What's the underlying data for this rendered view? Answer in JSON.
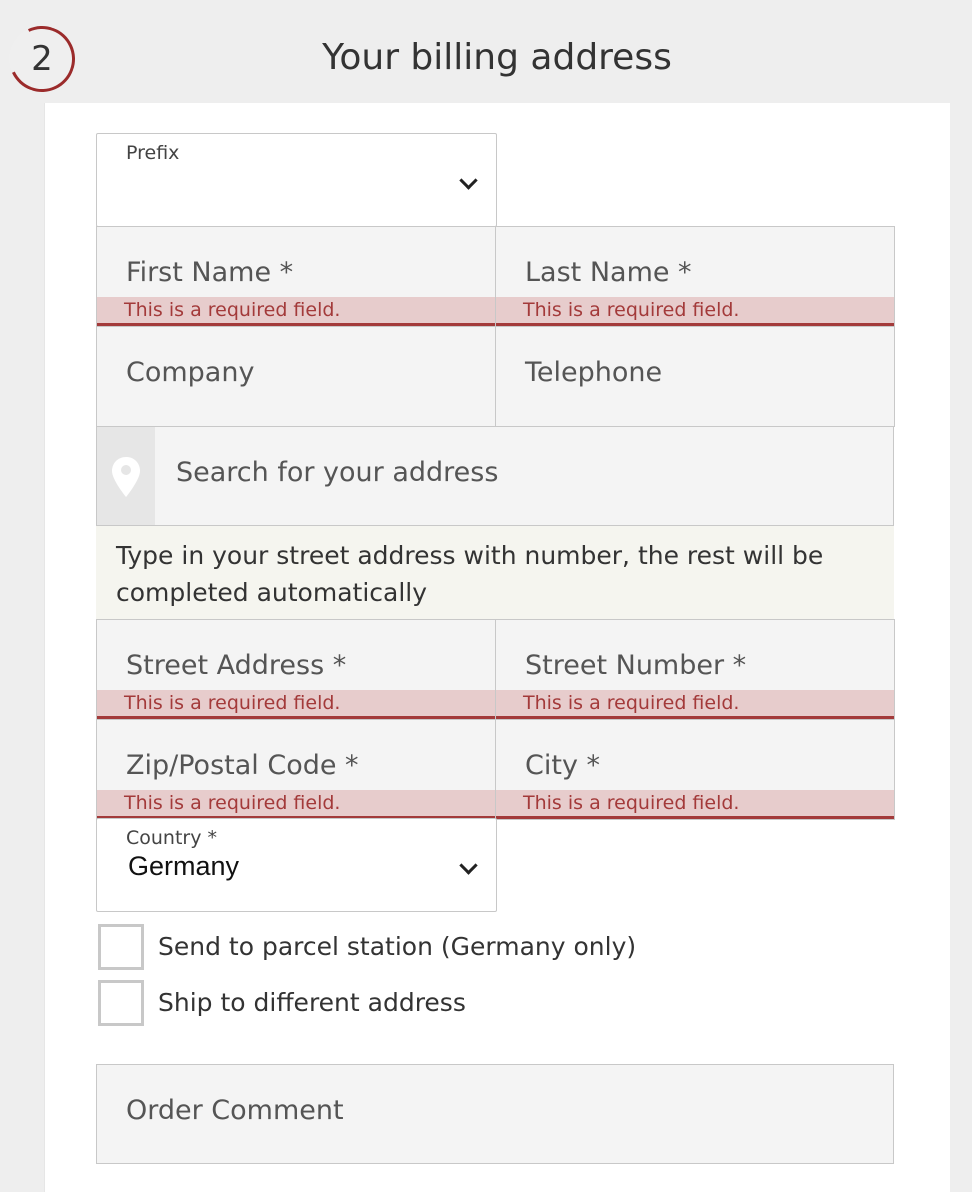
{
  "section": {
    "step_number": "2",
    "title": "Your billing address"
  },
  "form": {
    "prefix": {
      "label": "Prefix",
      "value": ""
    },
    "first_name": {
      "label": "First Name *",
      "error": "This is a required field."
    },
    "last_name": {
      "label": "Last Name *",
      "error": "This is a required field."
    },
    "company": {
      "label": "Company"
    },
    "telephone": {
      "label": "Telephone"
    },
    "address_search": {
      "placeholder": "Search for your address",
      "hint": "Type in your street address with number, the rest will be completed automatically"
    },
    "street_address": {
      "label": "Street Address *",
      "error": "This is a required field."
    },
    "street_number": {
      "label": "Street Number *",
      "error": "This is a required field."
    },
    "zip": {
      "label": "Zip/Postal Code *",
      "error": "This is a required field."
    },
    "city": {
      "label": "City *",
      "error": "This is a required field."
    },
    "country": {
      "label": "Country *",
      "value": "Germany"
    },
    "parcel_station": {
      "label": "Send to parcel station (Germany only)",
      "checked": false
    },
    "ship_different": {
      "label": "Ship to different address",
      "checked": false
    },
    "order_comment": {
      "label": "Order Comment"
    }
  },
  "colors": {
    "accent": "#9b2b2b",
    "error_text": "#a33a3a",
    "error_bg": "#e7cccc",
    "field_bg": "#f4f4f4",
    "header_bg": "#eeeeee"
  },
  "icons": {
    "location": "map-pin-icon",
    "dropdown": "chevron-down-icon"
  }
}
